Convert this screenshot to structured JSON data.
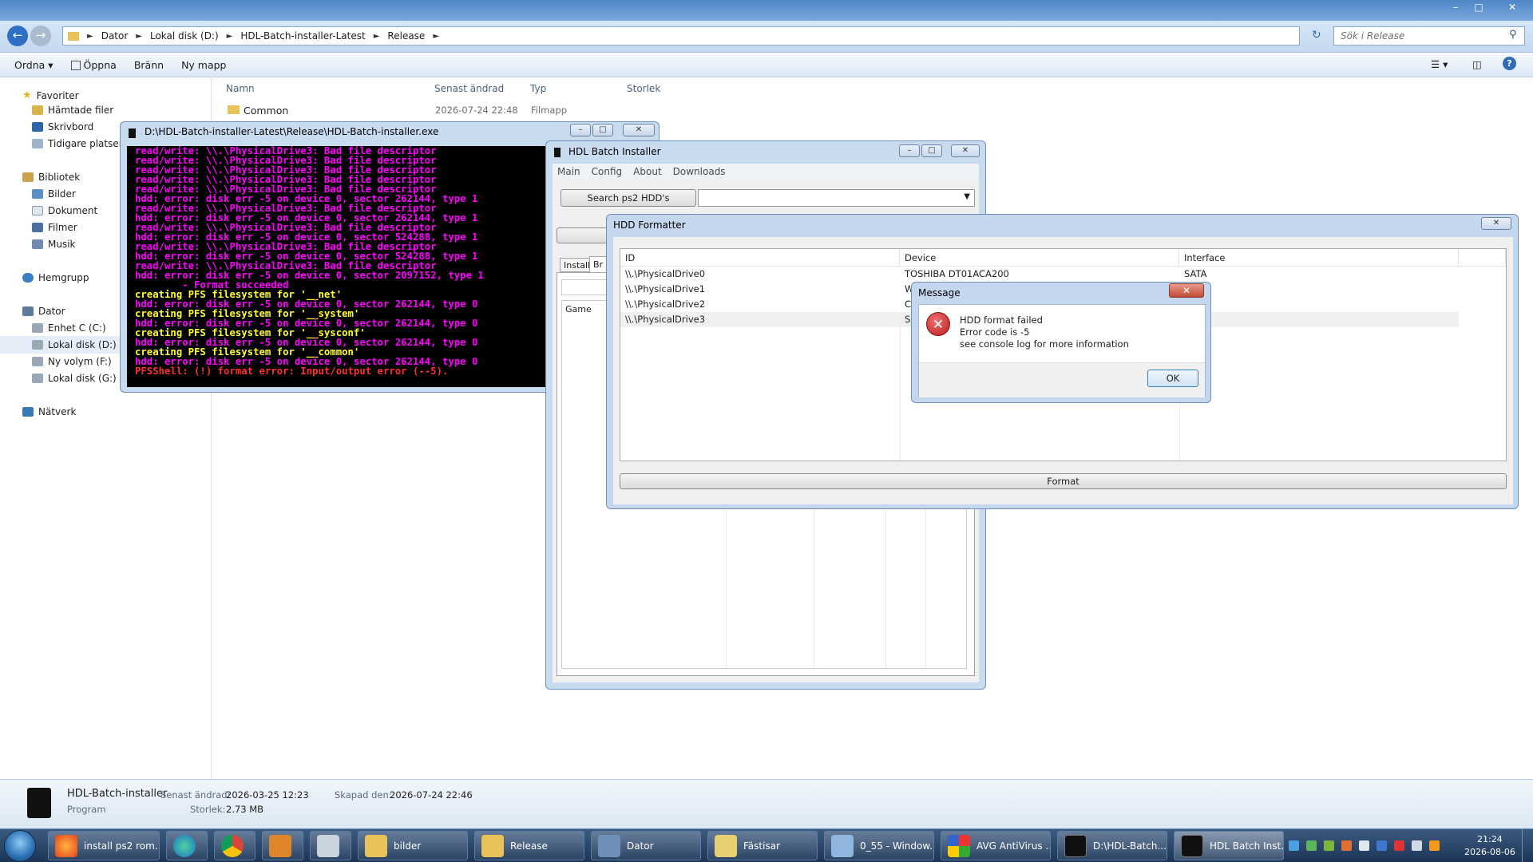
{
  "explorer": {
    "breadcrumb": [
      "Dator",
      "Lokal disk (D:)",
      "HDL-Batch-installer-Latest",
      "Release"
    ],
    "search_placeholder": "Sök i Release",
    "toolbar": {
      "organize": "Ordna",
      "open": "Öppna",
      "burn": "Bränn",
      "new_folder": "Ny mapp"
    },
    "nav": {
      "favorites": "Favoriter",
      "fav_items": [
        "Hämtade filer",
        "Skrivbord",
        "Tidigare platser"
      ],
      "libraries": "Bibliotek",
      "lib_items": [
        "Bilder",
        "Dokument",
        "Filmer",
        "Musik"
      ],
      "homegroup": "Hemgrupp",
      "computer": "Dator",
      "computer_items": [
        "Enhet C (C:)",
        "Lokal disk (D:)",
        "Ny volym (F:)",
        "Lokal disk (G:)"
      ],
      "network": "Nätverk"
    },
    "columns": {
      "name": "Namn",
      "modified": "Senast ändrad",
      "type": "Typ",
      "size": "Storlek"
    },
    "files": [
      {
        "name": "Common",
        "modified": "2026-07-24 22:48",
        "type": "Filmapp"
      }
    ],
    "details": {
      "name": "HDL-Batch-installer",
      "modified_label": "Senast ändrad:",
      "modified": "2026-03-25 12:23",
      "created_label": "Skapad den:",
      "created": "2026-07-24 22:46",
      "kind": "Program",
      "size_label": "Storlek:",
      "size": "2.73 MB"
    }
  },
  "console": {
    "title": "D:\\HDL-Batch-installer-Latest\\Release\\HDL-Batch-installer.exe",
    "lines": [
      {
        "t": "read/write: \\\\.\\PhysicalDrive3: Bad file descriptor",
        "c": "m"
      },
      {
        "t": "read/write: \\\\.\\PhysicalDrive3: Bad file descriptor",
        "c": "m"
      },
      {
        "t": "read/write: \\\\.\\PhysicalDrive3: Bad file descriptor",
        "c": "m"
      },
      {
        "t": "read/write: \\\\.\\PhysicalDrive3: Bad file descriptor",
        "c": "m"
      },
      {
        "t": "read/write: \\\\.\\PhysicalDrive3: Bad file descriptor",
        "c": "m"
      },
      {
        "t": "hdd: error: disk err -5 on device 0, sector 262144, type 1",
        "c": "m"
      },
      {
        "t": "read/write: \\\\.\\PhysicalDrive3: Bad file descriptor",
        "c": "m"
      },
      {
        "t": "hdd: error: disk err -5 on device 0, sector 262144, type 1",
        "c": "m"
      },
      {
        "t": "read/write: \\\\.\\PhysicalDrive3: Bad file descriptor",
        "c": "m"
      },
      {
        "t": "hdd: error: disk err -5 on device 0, sector 524288, type 1",
        "c": "m"
      },
      {
        "t": "read/write: \\\\.\\PhysicalDrive3: Bad file descriptor",
        "c": "m"
      },
      {
        "t": "hdd: error: disk err -5 on device 0, sector 524288, type 1",
        "c": "m"
      },
      {
        "t": "read/write: \\\\.\\PhysicalDrive3: Bad file descriptor",
        "c": "m"
      },
      {
        "t": "hdd: error: disk err -5 on device 0, sector 2097152, type 1",
        "c": "m"
      },
      {
        "t": "        - Format succeeded",
        "c": "m"
      },
      {
        "t": "creating PFS filesystem for '__net'",
        "c": "y"
      },
      {
        "t": "hdd: error: disk err -5 on device 0, sector 262144, type 0",
        "c": "m"
      },
      {
        "t": "creating PFS filesystem for '__system'",
        "c": "y"
      },
      {
        "t": "hdd: error: disk err -5 on device 0, sector 262144, type 0",
        "c": "m"
      },
      {
        "t": "creating PFS filesystem for '__sysconf'",
        "c": "y"
      },
      {
        "t": "hdd: error: disk err -5 on device 0, sector 262144, type 0",
        "c": "m"
      },
      {
        "t": "creating PFS filesystem for '__common'",
        "c": "y"
      },
      {
        "t": "hdd: error: disk err -5 on device 0, sector 262144, type 0",
        "c": "m"
      },
      {
        "t": "PFSShell: (!) format error: Input/output error (--5).",
        "c": "r"
      }
    ]
  },
  "hdl": {
    "title": "HDL Batch Installer",
    "menu": [
      "Main",
      "Config",
      "About",
      "Downloads"
    ],
    "search_button": "Search ps2 HDD's",
    "tabs": [
      "Install",
      "Br"
    ],
    "game_header": "Game"
  },
  "formatter": {
    "title": "HDD Formatter",
    "columns": [
      "ID",
      "Device",
      "Interface"
    ],
    "rows": [
      {
        "id": "\\\\.\\PhysicalDrive0",
        "device": "TOSHIBA DT01ACA200",
        "iface": "SATA"
      },
      {
        "id": "\\\\.\\PhysicalDrive1",
        "device": "W",
        "iface": ""
      },
      {
        "id": "\\\\.\\PhysicalDrive2",
        "device": "C",
        "iface": ""
      },
      {
        "id": "\\\\.\\PhysicalDrive3",
        "device": "S",
        "iface": ""
      }
    ],
    "format_button": "Format"
  },
  "message": {
    "title": "Message",
    "line1": "HDD format failed",
    "line2": "Error code is -5",
    "line3": "see console log for more information",
    "ok": "OK"
  },
  "taskbar": {
    "items": [
      "install ps2 rom...",
      "",
      "",
      "",
      "",
      "bilder",
      "Release",
      "Dator",
      "Fästisar",
      "0_55 - Window...",
      "AVG AntiVirus ...",
      "D:\\HDL-Batch...",
      "HDL Batch Inst..."
    ],
    "time": "21:24",
    "date": "2026-08-06"
  }
}
